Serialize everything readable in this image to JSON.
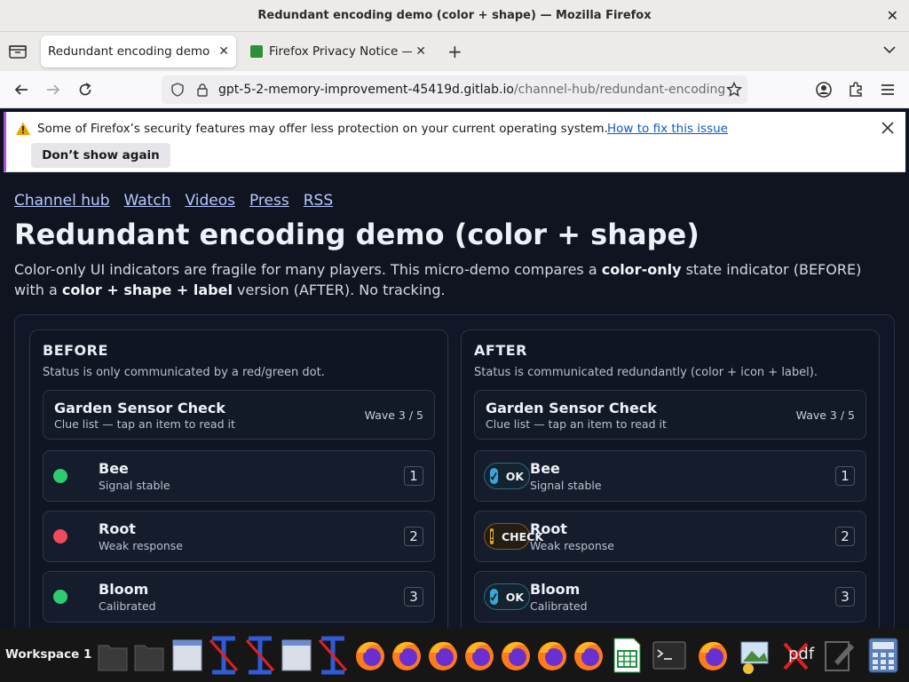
{
  "window": {
    "title": "Redundant encoding demo (color + shape) — Mozilla Firefox"
  },
  "tabs": [
    {
      "label": "Redundant encoding demo (",
      "active": true
    },
    {
      "label": "Firefox Privacy Notice — F",
      "active": false
    }
  ],
  "navbar": {
    "url_host": "gpt-5-2-memory-improvement-45419d.gitlab.io",
    "url_path": "/channel-hub/redundant-encoding"
  },
  "notification": {
    "text": "Some of Firefox’s security features may offer less protection on your current operating system.",
    "link": "How to fix this issue",
    "button": "Don’t show again"
  },
  "page": {
    "nav": [
      "Channel hub",
      "Watch",
      "Videos",
      "Press",
      "RSS"
    ],
    "title": "Redundant encoding demo (color + shape)",
    "intro": {
      "p1": "Color-only UI indicators are fragile for many players. This micro-demo compares a ",
      "b1": "color-only",
      "p2": " state indicator (BEFORE) with a ",
      "b2": "color + shape + label",
      "p3": " version (AFTER). No tracking."
    },
    "before": {
      "title": "BEFORE",
      "desc": "Status is only communicated by a red/green dot.",
      "card": {
        "title": "Garden Sensor Check",
        "sub": "Clue list — tap an item to read it",
        "wave": "Wave 3 / 5"
      },
      "rows": [
        {
          "name": "Bee",
          "sub": "Signal stable",
          "num": "1",
          "color": "#2ecc71"
        },
        {
          "name": "Root",
          "sub": "Weak response",
          "num": "2",
          "color": "#ef4b5a"
        },
        {
          "name": "Bloom",
          "sub": "Calibrated",
          "num": "3",
          "color": "#2ecc71"
        }
      ]
    },
    "after": {
      "title": "AFTER",
      "desc": "Status is communicated redundantly (color + icon + label).",
      "card": {
        "title": "Garden Sensor Check",
        "sub": "Clue list — tap an item to read it",
        "wave": "Wave 3 / 5"
      },
      "rows": [
        {
          "name": "Bee",
          "sub": "Signal stable",
          "num": "1",
          "status": "OK",
          "icon": "check-icon"
        },
        {
          "name": "Root",
          "sub": "Weak response",
          "num": "2",
          "status": "CHECK",
          "icon": "exclamation-icon"
        },
        {
          "name": "Bloom",
          "sub": "Calibrated",
          "num": "3",
          "status": "OK",
          "icon": "check-icon"
        }
      ]
    }
  },
  "taskbar": {
    "workspace": "Workspace 1",
    "pdf_label": "pdf"
  }
}
